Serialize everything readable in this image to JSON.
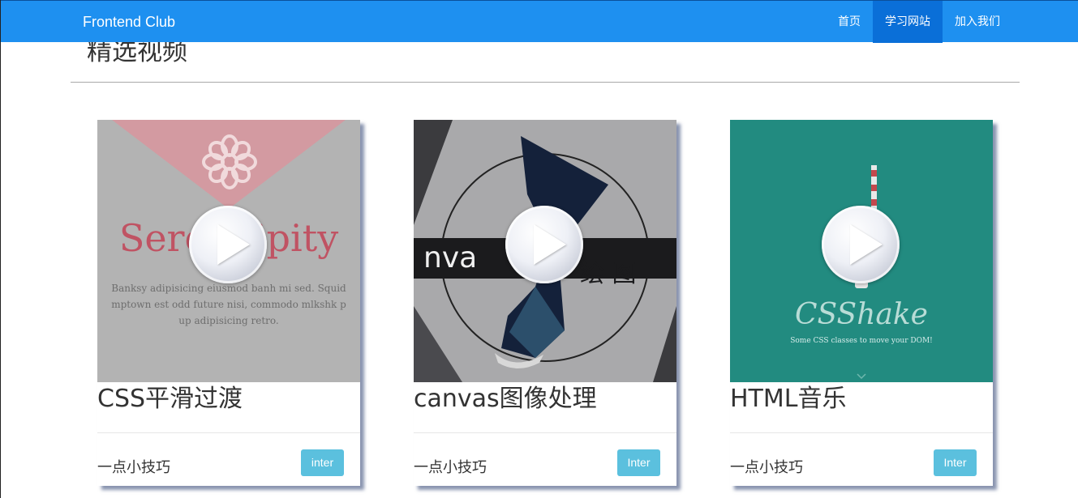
{
  "navbar": {
    "brand": "Frontend Club",
    "links": [
      {
        "label": "首页",
        "active": false
      },
      {
        "label": "学习网站",
        "active": true
      },
      {
        "label": "加入我们",
        "active": false
      }
    ]
  },
  "section": {
    "title": "精选视频"
  },
  "colors": {
    "navbar": "#1e90f0",
    "nav_active": "#0a6fd8",
    "button": "#5bc0de",
    "card3_bg": "#228b80"
  },
  "cards": [
    {
      "title": "CSS平滑过渡",
      "subtitle": "一点小技巧",
      "button": "inter",
      "thumb_icon": "play-icon",
      "thumb_text": {
        "word": "Serendipity",
        "body": [
          "Banksy adipisicing eiusmod banh mi sed. Squid",
          "mptown est odd future nisi, commodo mlkshk p",
          "up adipisicing retro."
        ]
      }
    },
    {
      "title": "canvas图像处理",
      "subtitle": "一点小技巧",
      "button": "Inter",
      "thumb_icon": "play-icon",
      "thumb_text": {
        "left": "nva",
        "right": "绘 图"
      }
    },
    {
      "title": "HTML音乐",
      "subtitle": "一点小技巧",
      "button": "Inter",
      "thumb_icon": "play-icon",
      "thumb_text": {
        "word": "CSShake",
        "tagline": "Some CSS classes to move your DOM!"
      }
    }
  ]
}
